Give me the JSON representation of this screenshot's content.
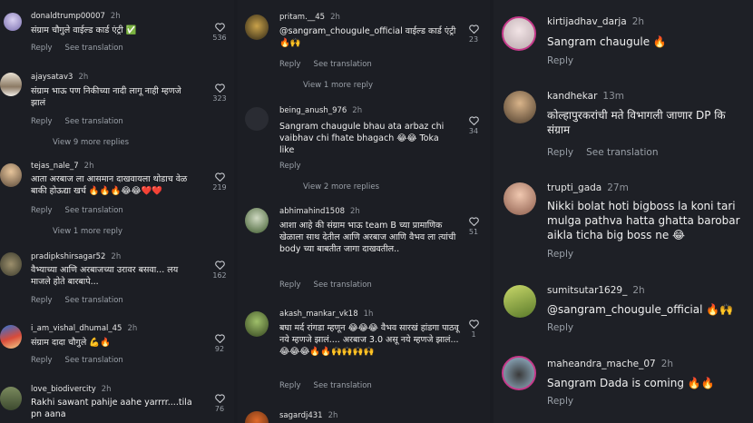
{
  "colors": {
    "background": "#1c1e24",
    "text": "#f0f0f0",
    "muted": "#9aa0a8"
  },
  "left_column": {
    "comments": [
      {
        "username": "donaldtrump00007",
        "time": "2h",
        "text": "संग्राम चौगुले वाईल्ड कार्ड एंट्री ✅",
        "actions": [
          "Reply",
          "See translation"
        ],
        "likes": "536"
      },
      {
        "username": "ajaysatav3",
        "time": "2h",
        "text": "संग्राम भाऊ पण निकीच्या नादी लागू नाही म्हणजे झालं",
        "actions": [
          "Reply",
          "See translation"
        ],
        "likes": "323",
        "view_replies": "View 9 more replies"
      },
      {
        "username": "tejas_nale_7",
        "time": "2h",
        "text": "आता अरबाज ला आसमान दाखवायला थोडाच वेळ बाकी होऊद्या खर्च 🔥🔥🔥😂😂❤️❤️",
        "actions": [
          "Reply",
          "See translation"
        ],
        "likes": "219",
        "view_replies": "View 1 more reply"
      },
      {
        "username": "pradipkshirsagar52",
        "time": "2h",
        "text": "वैभ्याच्या आणि अरबाजच्या उरावर बसवा... लय माजले होते बारबापे...",
        "actions": [
          "Reply",
          "See translation"
        ],
        "likes": "162"
      },
      {
        "username": "i_am_vishal_dhumal_45",
        "time": "2h",
        "text": "संग्राम दादा चौगुले 💪🔥",
        "actions": [
          "Reply",
          "See translation"
        ],
        "likes": "92"
      },
      {
        "username": "love_biodivercity",
        "time": "2h",
        "text": "Rakhi sawant pahije aahe yarrrr....tila pn aana",
        "likes": "76"
      }
    ]
  },
  "middle_column": {
    "comments": [
      {
        "username": "pritam.__45",
        "time": "2h",
        "text": "@sangram_chougule_official वाईल्ड कार्ड एंट्री 🔥🙌",
        "actions": [
          "Reply",
          "See translation"
        ],
        "likes": "23",
        "view_replies": "View 1 more reply"
      },
      {
        "username": "being_anush_976",
        "time": "2h",
        "text": "Sangram chaugule bhau ata arbaz chi vaibhav chi fhate bhagach 😂😂 Toka like",
        "actions": [
          "Reply"
        ],
        "likes": "34",
        "view_replies": "View 2 more replies"
      },
      {
        "username": "abhimahind1508",
        "time": "2h",
        "text": "आशा आहे की संग्राम भाऊ team B च्या प्रामाणिक खेळाला साथ देतील आणि अरबाज आणि वैभव ला त्यांची body च्या बाबतीत जागा दाखवतील..",
        "actions": [
          "Reply",
          "See translation"
        ],
        "likes": "51"
      },
      {
        "username": "akash_mankar_vk18",
        "time": "1h",
        "text": "बघा मर्द रांगडा म्हणून 😂😂😂 वैभव सारखं हांडगा पाठवू नये म्हणजे झालं.... अरबाज 3.0 असू नये म्हणजे झालं...😂😂😂🔥🔥🙌🙌🙌🙌",
        "actions": [
          "Reply",
          "See translation"
        ],
        "likes": "1"
      },
      {
        "username": "sagardj431",
        "time": "2h"
      }
    ]
  },
  "right_column": {
    "comments": [
      {
        "username": "kirtijadhav_darja",
        "time": "2h",
        "text": "Sangram chaugule 🔥",
        "actions": [
          "Reply"
        ]
      },
      {
        "username": "kandhekar",
        "time": "13m",
        "text": "कोल्हापुरकरांची मते विभागली जाणार DP कि संग्राम",
        "actions": [
          "Reply",
          "See translation"
        ]
      },
      {
        "username": "trupti_gada",
        "time": "27m",
        "text": "Nikki bolat hoti bigboss la koni tari mulga pathva hatta ghatta barobar aikla ticha big boss ne 😂",
        "actions": [
          "Reply"
        ]
      },
      {
        "username": "sumitsutar1629_",
        "time": "2h",
        "text": "@sangram_chougule_official 🔥🙌",
        "actions": [
          "Reply"
        ]
      },
      {
        "username": "maheandra_mache_07",
        "time": "2h",
        "text": "Sangram Dada is coming 🔥🔥",
        "actions": [
          "Reply"
        ]
      }
    ]
  }
}
